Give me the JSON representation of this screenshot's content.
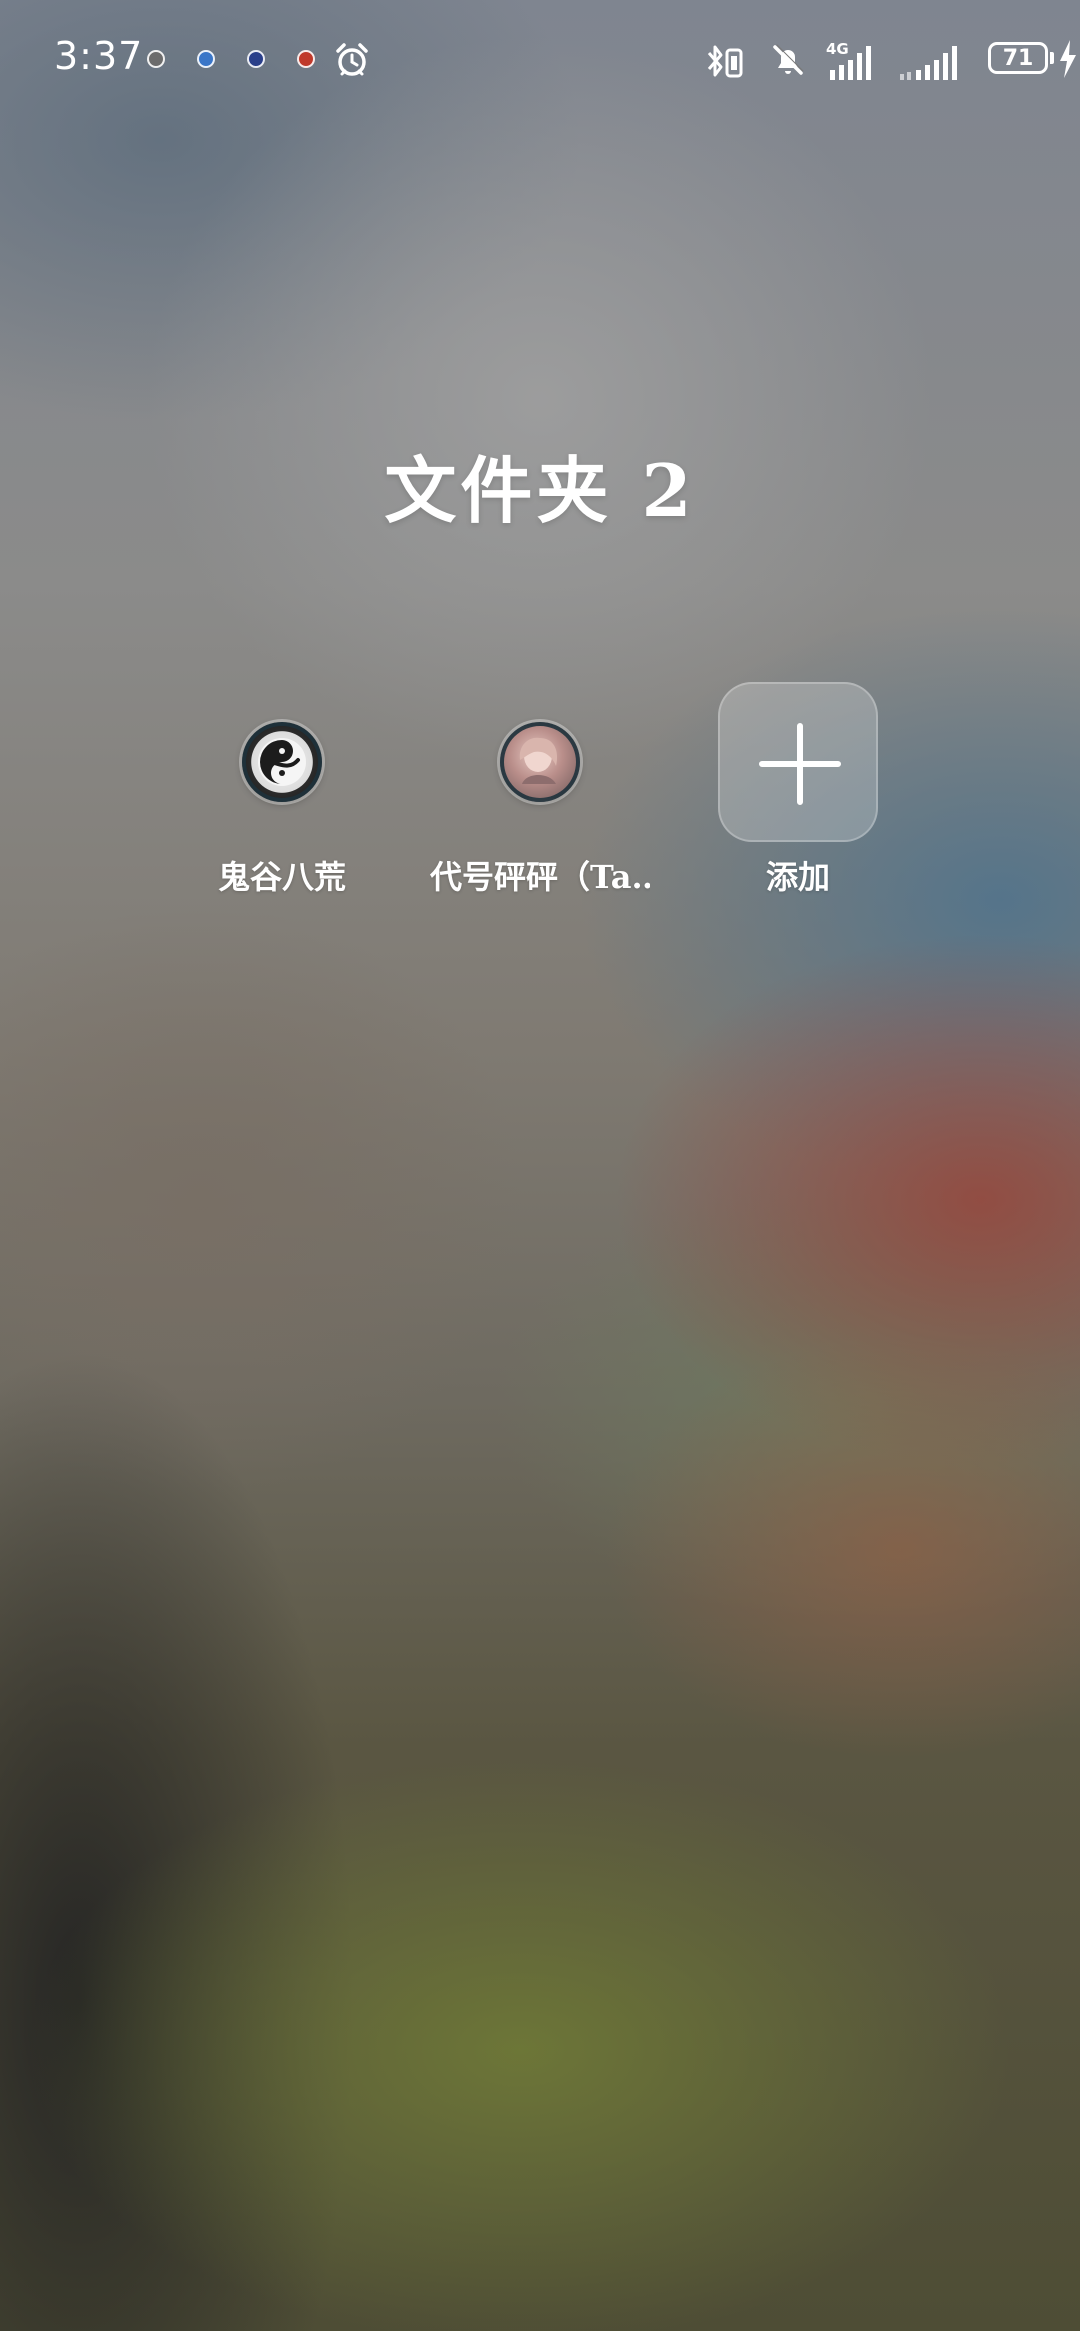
{
  "status_bar": {
    "time": "3:37",
    "notification_icons": [
      "app-notification-icon-1",
      "app-notification-icon-2",
      "app-notification-icon-3",
      "app-notification-icon-4"
    ],
    "notification_colors": [
      "#6c6c6c",
      "#3a76c8",
      "#2a3f8a",
      "#c0392b"
    ],
    "network_label": "4G",
    "battery_level": "71"
  },
  "folder": {
    "title": "文件夹 2",
    "apps": [
      {
        "label": "鬼谷八荒",
        "icon": "guiguBahuang-app-icon"
      },
      {
        "label": "代号砰砰（Ta‥",
        "icon": "daihao-pengpeng-app-icon"
      }
    ],
    "add_label": "添加"
  }
}
